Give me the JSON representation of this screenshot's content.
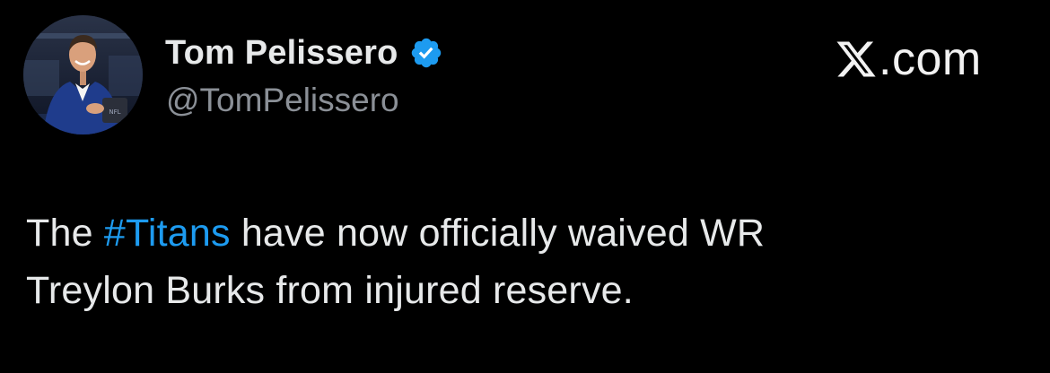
{
  "author": {
    "display_name": "Tom Pelissero",
    "handle": "@TomPelissero",
    "verified": true,
    "avatar_icon": "profile-photo"
  },
  "brand": {
    "label": ".com",
    "icon": "x-logo-icon"
  },
  "tweet": {
    "text_before": "The ",
    "hashtag": "#Titans",
    "text_line1_after": " have now officially waived WR",
    "text_line2": "Treylon Burks from injured reserve."
  },
  "colors": {
    "background": "#000000",
    "text": "#e7e9ea",
    "handle": "#8b9097",
    "hashtag": "#1d9bf0",
    "verified_badge": "#1d9bf0"
  }
}
